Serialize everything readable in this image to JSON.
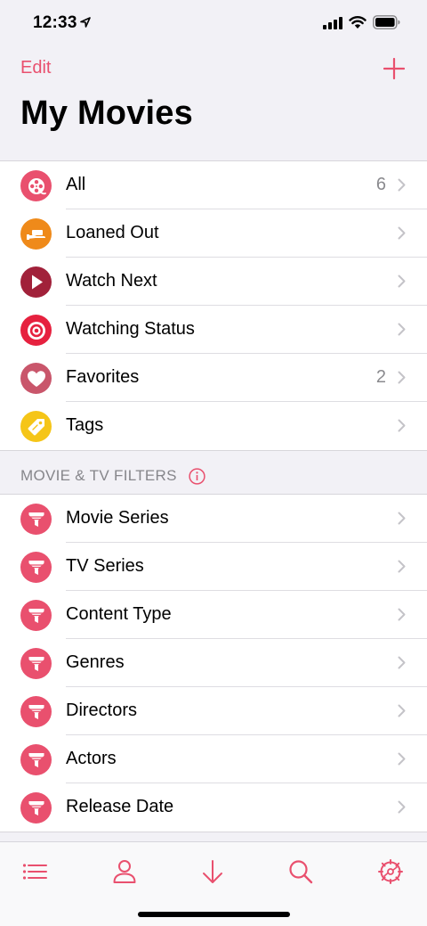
{
  "status_bar": {
    "time": "12:33"
  },
  "nav": {
    "edit_label": "Edit",
    "title": "My Movies"
  },
  "main_list": [
    {
      "label": "All",
      "count": "6",
      "icon": "film-reel-icon",
      "color": "#e9506e"
    },
    {
      "label": "Loaned Out",
      "count": "",
      "icon": "hand-ticket-icon",
      "color": "#ef8a1a"
    },
    {
      "label": "Watch Next",
      "count": "",
      "icon": "play-icon",
      "color": "#a1213a"
    },
    {
      "label": "Watching Status",
      "count": "",
      "icon": "target-icon",
      "color": "#e6213f"
    },
    {
      "label": "Favorites",
      "count": "2",
      "icon": "heart-icon",
      "color": "#c9566b"
    },
    {
      "label": "Tags",
      "count": "",
      "icon": "tag-icon",
      "color": "#f5c518"
    }
  ],
  "section_header": "MOVIE & TV FILTERS",
  "filters": [
    {
      "label": "Movie Series",
      "icon": "filter-icon"
    },
    {
      "label": "TV Series",
      "icon": "filter-icon"
    },
    {
      "label": "Content Type",
      "icon": "filter-icon"
    },
    {
      "label": "Genres",
      "icon": "filter-icon"
    },
    {
      "label": "Directors",
      "icon": "filter-icon"
    },
    {
      "label": "Actors",
      "icon": "filter-icon"
    },
    {
      "label": "Release Date",
      "icon": "filter-icon"
    }
  ],
  "colors": {
    "accent": "#e9506e",
    "filter_icon_bg": "#e9506e"
  },
  "tab_bar": [
    "list-icon",
    "person-icon",
    "download-icon",
    "search-icon",
    "settings-icon"
  ]
}
